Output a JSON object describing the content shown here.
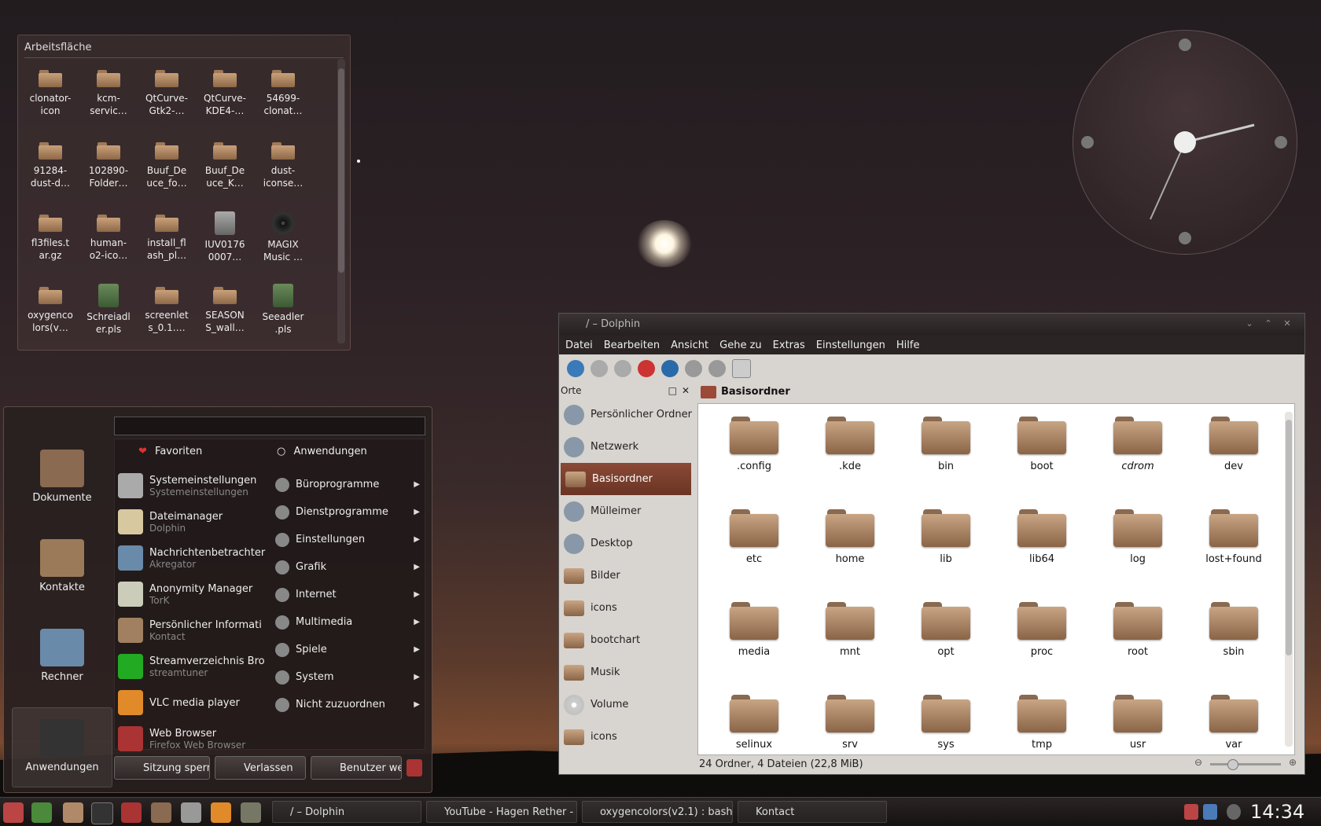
{
  "folderview": {
    "title": "Arbeitsfläche",
    "items": [
      {
        "label": "clonator-\nicon",
        "type": "folder"
      },
      {
        "label": "kcm-\nservic…",
        "type": "folder"
      },
      {
        "label": "QtCurve-\nGtk2-…",
        "type": "folder"
      },
      {
        "label": "QtCurve-\nKDE4-…",
        "type": "folder"
      },
      {
        "label": "54699-\nclonat…",
        "type": "folder"
      },
      {
        "label": "91284-\ndust-d…",
        "type": "folder"
      },
      {
        "label": "102890-\nFolder…",
        "type": "folder"
      },
      {
        "label": "Buuf_De\nuce_fo…",
        "type": "folder"
      },
      {
        "label": "Buuf_De\nuce_K…",
        "type": "folder"
      },
      {
        "label": "dust-\niconse…",
        "type": "folder"
      },
      {
        "label": "fl3files.t\nar.gz",
        "type": "folder"
      },
      {
        "label": "human-\no2-ico…",
        "type": "folder"
      },
      {
        "label": "install_fl\nash_pl…",
        "type": "folder"
      },
      {
        "label": "IUV0176\n0007…",
        "type": "image"
      },
      {
        "label": "MAGIX\nMusic …",
        "type": "disc"
      },
      {
        "label": "oxygenco\nlors(v…",
        "type": "folder"
      },
      {
        "label": "Schreiadl\ner.pls",
        "type": "pls"
      },
      {
        "label": "screenlet\ns_0.1.…",
        "type": "folder"
      },
      {
        "label": "SEASON\nS_wall…",
        "type": "folder"
      },
      {
        "label": "Seeadler\n.pls",
        "type": "pls"
      }
    ]
  },
  "kickoff": {
    "search_value": "",
    "side": [
      {
        "label": "Dokumente",
        "icon": "desk-icon"
      },
      {
        "label": "Kontakte",
        "icon": "contacts-icon"
      },
      {
        "label": "Rechner",
        "icon": "computer-icon"
      },
      {
        "label": "Anwendungen",
        "icon": "hat-icon"
      }
    ],
    "favorites_header": "Favoriten",
    "applications_header": "Anwendungen",
    "favorites": [
      {
        "name": "Systemeinstellungen",
        "sub": "Systemeinstellungen",
        "icon": "tools-icon"
      },
      {
        "name": "Dateimanager",
        "sub": "Dolphin",
        "icon": "file-manager-icon"
      },
      {
        "name": "Nachrichtenbetrachter",
        "sub": "Akregator",
        "icon": "news-icon"
      },
      {
        "name": "Anonymity Manager",
        "sub": "TorK",
        "icon": "onion-icon"
      },
      {
        "name": "Persönlicher Informati",
        "sub": "Kontact",
        "icon": "kontact-icon"
      },
      {
        "name": "Streamverzeichnis Bro",
        "sub": "streamtuner",
        "icon": "play-icon"
      },
      {
        "name": "VLC media player",
        "sub": "",
        "icon": "vlc-icon"
      },
      {
        "name": "Web Browser",
        "sub": "Firefox Web Browser",
        "icon": "firefox-icon"
      }
    ],
    "applications": [
      "Büroprogramme",
      "Dienstprogramme",
      "Einstellungen",
      "Grafik",
      "Internet",
      "Multimedia",
      "Spiele",
      "System",
      "Nicht zuzuordnen"
    ],
    "buttons": {
      "lock": "Sitzung sperr",
      "leave": "Verlassen",
      "switch": "Benutzer wec"
    }
  },
  "dolphin": {
    "title": "/ – Dolphin",
    "menu": [
      "Datei",
      "Bearbeiten",
      "Ansicht",
      "Gehe zu",
      "Extras",
      "Einstellungen",
      "Hilfe"
    ],
    "places_header": "Orte",
    "places": [
      {
        "label": "Persönlicher Ordner",
        "icon": "home-icon"
      },
      {
        "label": "Netzwerk",
        "icon": "network-icon"
      },
      {
        "label": "Basisordner",
        "icon": "folder-icon",
        "selected": true
      },
      {
        "label": "Mülleimer",
        "icon": "trash-icon"
      },
      {
        "label": "Desktop",
        "icon": "desktop-icon"
      },
      {
        "label": "Bilder",
        "icon": "folder-icon"
      },
      {
        "label": "icons",
        "icon": "folder-icon"
      },
      {
        "label": "bootchart",
        "icon": "folder-icon"
      },
      {
        "label": "Musik",
        "icon": "folder-icon"
      },
      {
        "label": "Volume",
        "icon": "disc-icon"
      },
      {
        "label": "icons",
        "icon": "folder-icon"
      }
    ],
    "breadcrumb": "Basisordner",
    "files": [
      ".config",
      ".kde",
      "bin",
      "boot",
      "cdrom",
      "dev",
      "etc",
      "home",
      "lib",
      "lib64",
      "log",
      "lost+found",
      "media",
      "mnt",
      "opt",
      "proc",
      "root",
      "sbin",
      "selinux",
      "srv",
      "sys",
      "tmp",
      "usr",
      "var"
    ],
    "status": "24 Ordner, 4 Dateien (22,8 MiB)"
  },
  "taskbar": {
    "tasks": [
      "/ – Dolphin",
      "YouTube - Hagen Rether - M",
      "oxygencolors(v2.1) : bash",
      "Kontact"
    ],
    "time": "14:34"
  },
  "colors": {
    "accent": "#7a3c2a",
    "folder": "#b08a68"
  }
}
